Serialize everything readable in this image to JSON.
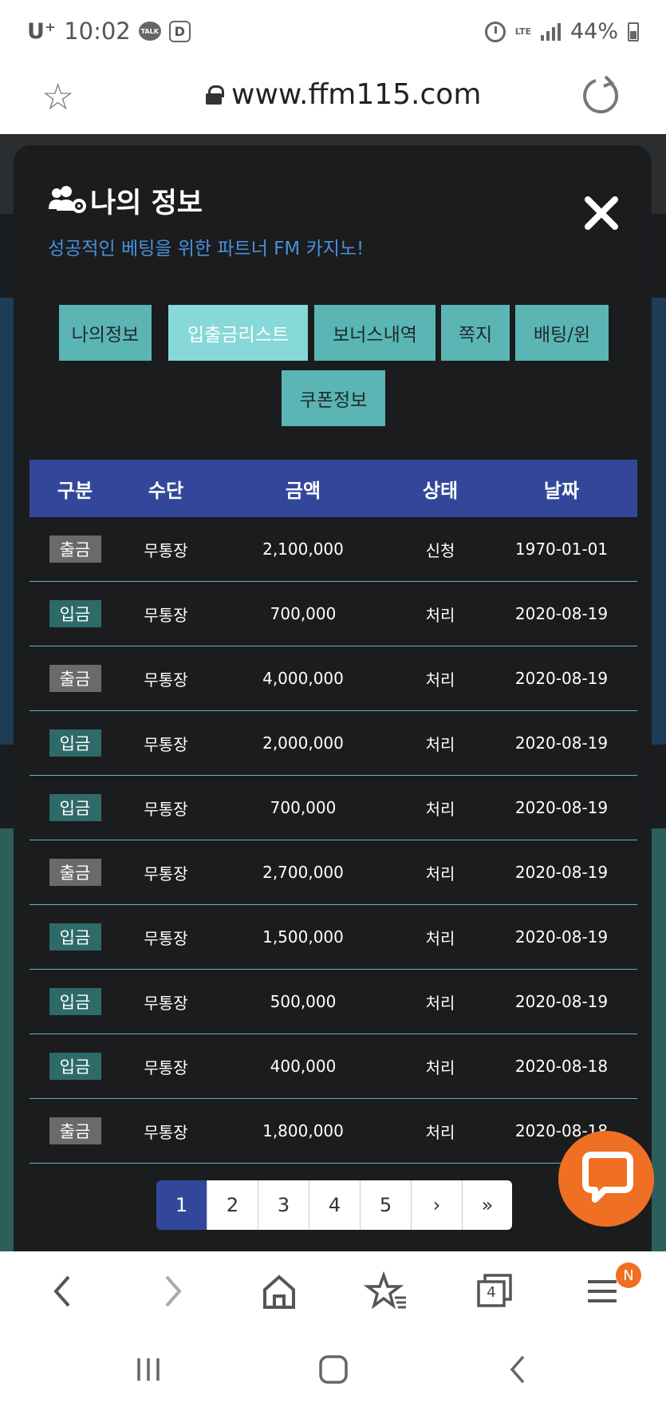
{
  "status_bar": {
    "carrier": "U⁺",
    "time": "10:02",
    "talk_icon_label": "TALK",
    "d_icon_label": "D",
    "network": "LTE",
    "battery": "44%"
  },
  "browser": {
    "url": "www.ffm115.com"
  },
  "modal": {
    "title": "나의 정보",
    "subtitle": "성공적인 베팅을 위한 파트너 FM 카지노!",
    "tabs": [
      {
        "label": "나의정보",
        "active": false
      },
      {
        "label": "입출금리스트",
        "active": true
      },
      {
        "label": "보너스내역",
        "active": false
      },
      {
        "label": "쪽지",
        "active": false
      },
      {
        "label": "배팅/윈",
        "active": false
      },
      {
        "label": "쿠폰정보",
        "active": false
      }
    ],
    "table": {
      "headers": [
        "구분",
        "수단",
        "금액",
        "상태",
        "날짜"
      ],
      "rows": [
        {
          "type": "출금",
          "method": "무통장",
          "amount": "2,100,000",
          "status": "신청",
          "date": "1970-01-01"
        },
        {
          "type": "입금",
          "method": "무통장",
          "amount": "700,000",
          "status": "처리",
          "date": "2020-08-19"
        },
        {
          "type": "출금",
          "method": "무통장",
          "amount": "4,000,000",
          "status": "처리",
          "date": "2020-08-19"
        },
        {
          "type": "입금",
          "method": "무통장",
          "amount": "2,000,000",
          "status": "처리",
          "date": "2020-08-19"
        },
        {
          "type": "입금",
          "method": "무통장",
          "amount": "700,000",
          "status": "처리",
          "date": "2020-08-19"
        },
        {
          "type": "출금",
          "method": "무통장",
          "amount": "2,700,000",
          "status": "처리",
          "date": "2020-08-19"
        },
        {
          "type": "입금",
          "method": "무통장",
          "amount": "1,500,000",
          "status": "처리",
          "date": "2020-08-19"
        },
        {
          "type": "입금",
          "method": "무통장",
          "amount": "500,000",
          "status": "처리",
          "date": "2020-08-19"
        },
        {
          "type": "입금",
          "method": "무통장",
          "amount": "400,000",
          "status": "처리",
          "date": "2020-08-18"
        },
        {
          "type": "출금",
          "method": "무통장",
          "amount": "1,800,000",
          "status": "처리",
          "date": "2020-08-18"
        }
      ]
    },
    "pagination": [
      "1",
      "2",
      "3",
      "4",
      "5",
      "›",
      "»"
    ]
  },
  "bottom_nav": {
    "tabs_count": "4",
    "menu_badge": "N"
  },
  "colors": {
    "header_blue": "#33479a",
    "tab_teal": "#5bb5b5",
    "tab_active": "#87d8d8",
    "chat_orange": "#ef6f23",
    "subtitle_blue": "#4a90d9"
  }
}
